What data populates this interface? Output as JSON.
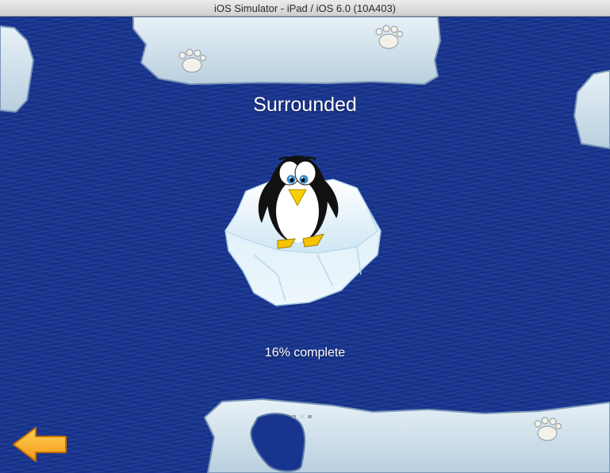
{
  "window": {
    "title": "iOS Simulator - iPad / iOS 6.0 (10A403)"
  },
  "level": {
    "title": "Surrounded",
    "progress_text": "16% complete",
    "progress_fraction": 0.16
  },
  "pager": {
    "page_count": 3,
    "current_page": 2
  },
  "icons": {
    "back": "back-arrow-icon",
    "bear_paw": "polar-bear-paw-icon",
    "penguin": "penguin-icon",
    "ice_floe": "ice-floe-icon"
  },
  "colors": {
    "sea": "#16338f",
    "ice": "#cfe2ee",
    "arrow": "#f3a312",
    "text": "#ffffff"
  }
}
